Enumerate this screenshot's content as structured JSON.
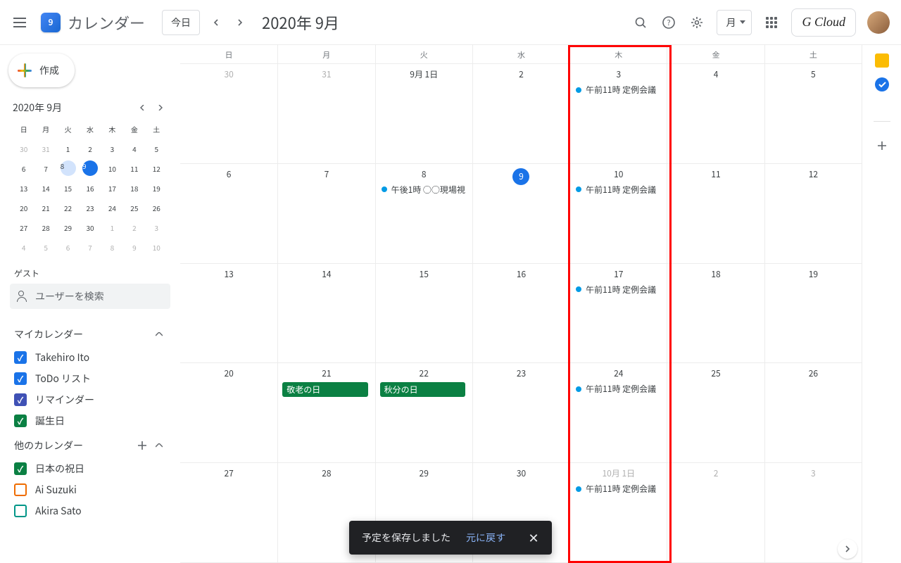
{
  "header": {
    "app_title": "カレンダー",
    "logo_day": "9",
    "today_btn": "今日",
    "period": "2020年 9月",
    "view_label": "月",
    "brand": "G Cloud"
  },
  "create_btn": "作成",
  "mini": {
    "title": "2020年 9月",
    "dow": [
      "日",
      "月",
      "火",
      "水",
      "木",
      "金",
      "土"
    ],
    "rows": [
      [
        {
          "d": "30",
          "dim": true
        },
        {
          "d": "31",
          "dim": true
        },
        {
          "d": "1"
        },
        {
          "d": "2"
        },
        {
          "d": "3"
        },
        {
          "d": "4"
        },
        {
          "d": "5"
        }
      ],
      [
        {
          "d": "6"
        },
        {
          "d": "7"
        },
        {
          "d": "8",
          "sel": true
        },
        {
          "d": "9",
          "today": true
        },
        {
          "d": "10"
        },
        {
          "d": "11"
        },
        {
          "d": "12"
        }
      ],
      [
        {
          "d": "13"
        },
        {
          "d": "14"
        },
        {
          "d": "15"
        },
        {
          "d": "16"
        },
        {
          "d": "17"
        },
        {
          "d": "18"
        },
        {
          "d": "19"
        }
      ],
      [
        {
          "d": "20"
        },
        {
          "d": "21"
        },
        {
          "d": "22"
        },
        {
          "d": "23"
        },
        {
          "d": "24"
        },
        {
          "d": "25"
        },
        {
          "d": "26"
        }
      ],
      [
        {
          "d": "27"
        },
        {
          "d": "28"
        },
        {
          "d": "29"
        },
        {
          "d": "30"
        },
        {
          "d": "1",
          "dim": true
        },
        {
          "d": "2",
          "dim": true
        },
        {
          "d": "3",
          "dim": true
        }
      ],
      [
        {
          "d": "4",
          "dim": true
        },
        {
          "d": "5",
          "dim": true
        },
        {
          "d": "6",
          "dim": true
        },
        {
          "d": "7",
          "dim": true
        },
        {
          "d": "8",
          "dim": true
        },
        {
          "d": "9",
          "dim": true
        },
        {
          "d": "10",
          "dim": true
        }
      ]
    ]
  },
  "guest_label": "ゲスト",
  "search_placeholder": "ユーザーを検索",
  "my_cal_label": "マイカレンダー",
  "other_cal_label": "他のカレンダー",
  "my_calendars": [
    {
      "name": "Takehiro Ito",
      "color": "#1a73e8",
      "checked": true
    },
    {
      "name": "ToDo リスト",
      "color": "#1a73e8",
      "checked": true
    },
    {
      "name": "リマインダー",
      "color": "#3f51b5",
      "checked": true
    },
    {
      "name": "誕生日",
      "color": "#0b8043",
      "checked": true
    }
  ],
  "other_calendars": [
    {
      "name": "日本の祝日",
      "color": "#0b8043",
      "checked": true
    },
    {
      "name": "Ai Suzuki",
      "color": "#ef6c00",
      "checked": false
    },
    {
      "name": "Akira Sato",
      "color": "#009688",
      "checked": false
    }
  ],
  "dow_main": [
    "日",
    "月",
    "火",
    "水",
    "木",
    "金",
    "土"
  ],
  "weeks": [
    [
      {
        "num": "30",
        "dim": true
      },
      {
        "num": "31",
        "dim": true
      },
      {
        "num": "9月 1日"
      },
      {
        "num": "2"
      },
      {
        "num": "3",
        "events": [
          {
            "t": "午前11時 定例会議"
          }
        ]
      },
      {
        "num": "4"
      },
      {
        "num": "5"
      }
    ],
    [
      {
        "num": "6"
      },
      {
        "num": "7"
      },
      {
        "num": "8",
        "events": [
          {
            "t": "午後1時 ○○現場視"
          }
        ]
      },
      {
        "num": "9",
        "today": true
      },
      {
        "num": "10",
        "events": [
          {
            "t": "午前11時 定例会議"
          }
        ]
      },
      {
        "num": "11"
      },
      {
        "num": "12"
      }
    ],
    [
      {
        "num": "13"
      },
      {
        "num": "14"
      },
      {
        "num": "15"
      },
      {
        "num": "16"
      },
      {
        "num": "17",
        "events": [
          {
            "t": "午前11時 定例会議"
          }
        ]
      },
      {
        "num": "18"
      },
      {
        "num": "19"
      }
    ],
    [
      {
        "num": "20"
      },
      {
        "num": "21",
        "holiday": "敬老の日"
      },
      {
        "num": "22",
        "holiday": "秋分の日"
      },
      {
        "num": "23"
      },
      {
        "num": "24",
        "events": [
          {
            "t": "午前11時 定例会議"
          }
        ]
      },
      {
        "num": "25"
      },
      {
        "num": "26"
      }
    ],
    [
      {
        "num": "27"
      },
      {
        "num": "28"
      },
      {
        "num": "29"
      },
      {
        "num": "30"
      },
      {
        "num": "10月 1日",
        "dim": true,
        "events": [
          {
            "t": "午前11時 定例会議"
          }
        ]
      },
      {
        "num": "2",
        "dim": true
      },
      {
        "num": "3",
        "dim": true
      }
    ]
  ],
  "toast": {
    "msg": "予定を保存しました",
    "undo": "元に戻す"
  }
}
